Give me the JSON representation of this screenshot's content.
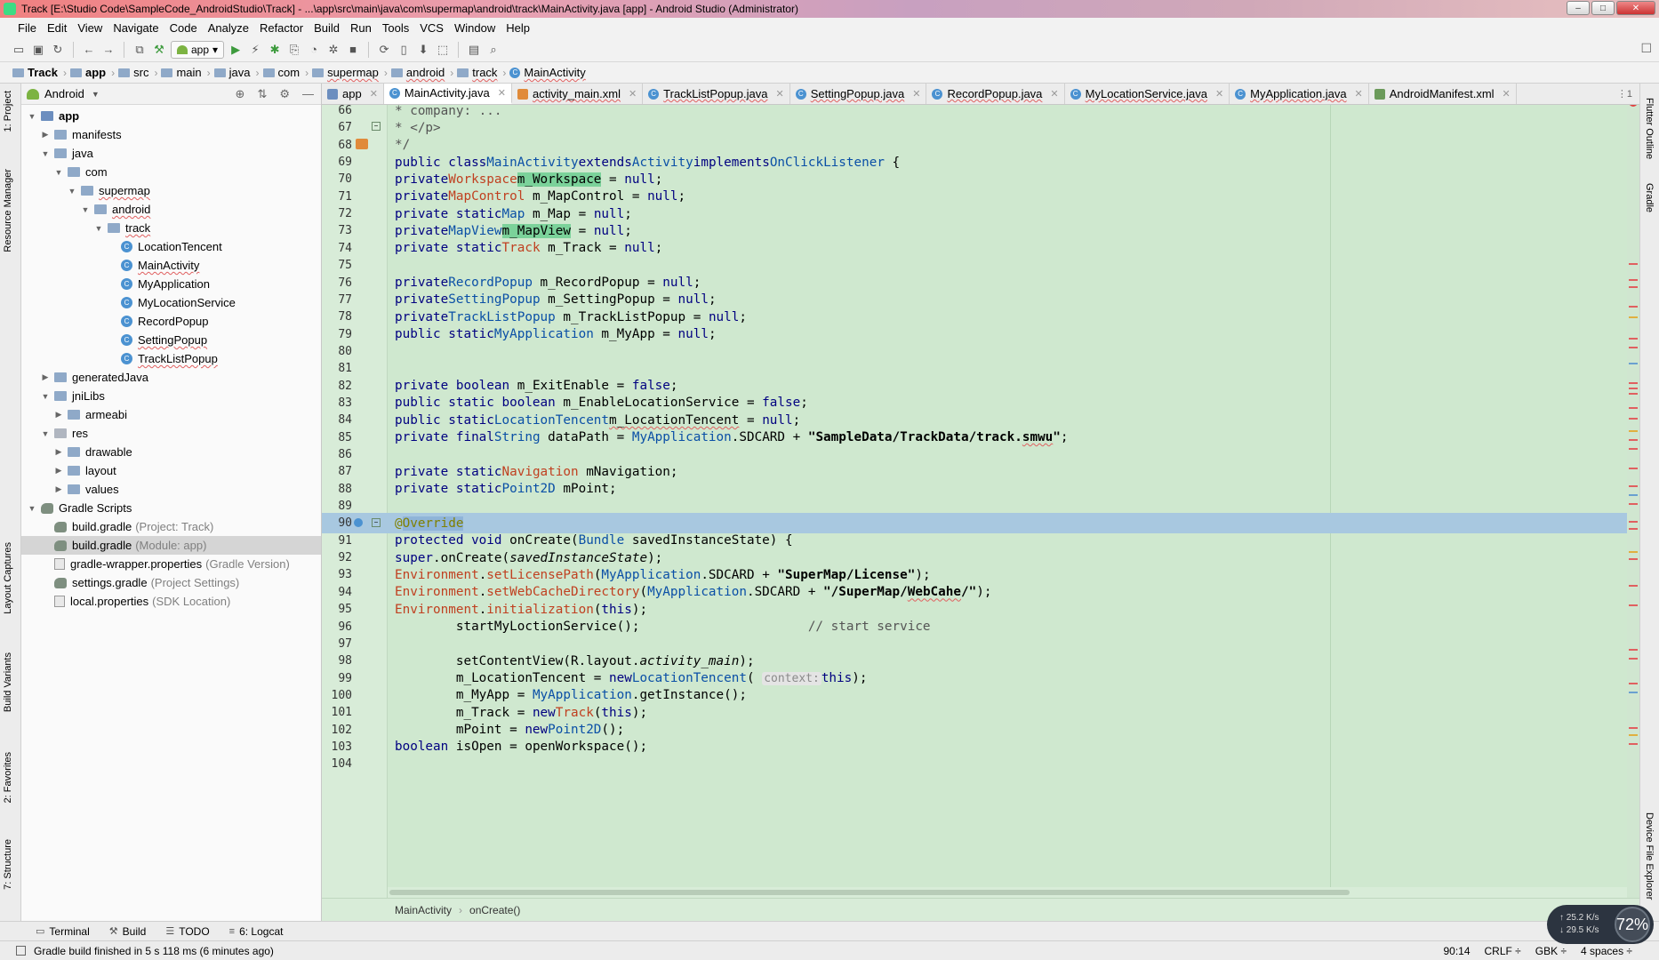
{
  "window": {
    "title": "Track [E:\\Studio Code\\SampleCode_AndroidStudio\\Track] - ...\\app\\src\\main\\java\\com\\supermap\\android\\track\\MainActivity.java [app] - Android Studio (Administrator)",
    "min": "–",
    "max": "□",
    "close": "✕"
  },
  "menu": [
    "File",
    "Edit",
    "View",
    "Navigate",
    "Code",
    "Analyze",
    "Refactor",
    "Build",
    "Run",
    "Tools",
    "VCS",
    "Window",
    "Help"
  ],
  "toolbar": {
    "run_config": "app"
  },
  "breadcrumb": [
    "Track",
    "app",
    "src",
    "main",
    "java",
    "com",
    "supermap",
    "android",
    "track",
    "MainActivity"
  ],
  "left_strip": [
    "1: Project",
    "Resource Manager",
    "Layout Captures",
    "Build Variants",
    "2: Favorites",
    "7: Structure"
  ],
  "right_strip": [
    "Flutter Outline",
    "Gradle",
    "Device File Explorer"
  ],
  "project": {
    "view": "Android",
    "tree": [
      {
        "label": "app",
        "indent": 0,
        "kind": "module",
        "expanded": true
      },
      {
        "label": "manifests",
        "indent": 1,
        "kind": "folder",
        "expanded": false
      },
      {
        "label": "java",
        "indent": 1,
        "kind": "folder",
        "expanded": true
      },
      {
        "label": "com",
        "indent": 2,
        "kind": "pkg",
        "expanded": true
      },
      {
        "label": "supermap",
        "indent": 3,
        "kind": "pkg",
        "expanded": true,
        "err": true
      },
      {
        "label": "android",
        "indent": 4,
        "kind": "pkg",
        "expanded": true,
        "err": true
      },
      {
        "label": "track",
        "indent": 5,
        "kind": "pkg",
        "expanded": true,
        "err": true
      },
      {
        "label": "LocationTencent",
        "indent": 6,
        "kind": "class"
      },
      {
        "label": "MainActivity",
        "indent": 6,
        "kind": "class",
        "err": true
      },
      {
        "label": "MyApplication",
        "indent": 6,
        "kind": "class"
      },
      {
        "label": "MyLocationService",
        "indent": 6,
        "kind": "class"
      },
      {
        "label": "RecordPopup",
        "indent": 6,
        "kind": "class"
      },
      {
        "label": "SettingPopup",
        "indent": 6,
        "kind": "class",
        "err": true
      },
      {
        "label": "TrackListPopup",
        "indent": 6,
        "kind": "class",
        "err": true
      },
      {
        "label": "generatedJava",
        "indent": 1,
        "kind": "folder",
        "expanded": false
      },
      {
        "label": "jniLibs",
        "indent": 1,
        "kind": "folder",
        "expanded": true
      },
      {
        "label": "armeabi",
        "indent": 2,
        "kind": "folder",
        "expanded": false
      },
      {
        "label": "res",
        "indent": 1,
        "kind": "res",
        "expanded": true
      },
      {
        "label": "drawable",
        "indent": 2,
        "kind": "folder",
        "expanded": false
      },
      {
        "label": "layout",
        "indent": 2,
        "kind": "folder",
        "expanded": false
      },
      {
        "label": "values",
        "indent": 2,
        "kind": "folder",
        "expanded": false
      },
      {
        "label": "Gradle Scripts",
        "indent": 0,
        "kind": "gradle",
        "expanded": true
      },
      {
        "label": "build.gradle",
        "hint": "(Project: Track)",
        "indent": 1,
        "kind": "gfile"
      },
      {
        "label": "build.gradle",
        "hint": "(Module: app)",
        "indent": 1,
        "kind": "gfile",
        "selected": true
      },
      {
        "label": "gradle-wrapper.properties",
        "hint": "(Gradle Version)",
        "indent": 1,
        "kind": "pfile"
      },
      {
        "label": "settings.gradle",
        "hint": "(Project Settings)",
        "indent": 1,
        "kind": "gfile"
      },
      {
        "label": "local.properties",
        "hint": "(SDK Location)",
        "indent": 1,
        "kind": "pfile"
      }
    ]
  },
  "tabs": [
    {
      "label": "app",
      "kind": "mod"
    },
    {
      "label": "MainActivity.java",
      "kind": "class",
      "active": true
    },
    {
      "label": "activity_main.xml",
      "kind": "xml"
    },
    {
      "label": "TrackListPopup.java",
      "kind": "class"
    },
    {
      "label": "SettingPopup.java",
      "kind": "class"
    },
    {
      "label": "RecordPopup.java",
      "kind": "class"
    },
    {
      "label": "MyLocationService.java",
      "kind": "class"
    },
    {
      "label": "MyApplication.java",
      "kind": "class"
    },
    {
      "label": "AndroidManifest.xml",
      "kind": "mf"
    }
  ],
  "tabs_more": "⋮1",
  "editor": {
    "lines": [
      {
        "n": "66",
        "html": " <span class='cm'>* company: ...</span>"
      },
      {
        "n": "67",
        "html": " <span class='cm'>* &lt;/p&gt;</span>"
      },
      {
        "n": "68",
        "html": " <span class='cm'>*/</span>"
      },
      {
        "n": "69",
        "html": "<span class='kw'>public class</span> <span class='ty'>MainActivity</span> <span class='kw'>extends</span> <span class='ty'>Activity</span> <span class='kw'>implements</span> <span class='ty'>OnClickListener</span> {"
      },
      {
        "n": "70",
        "html": "    <span class='kw'>private</span> <span class='red'>Workspace</span> <span class='hlw'>m_Workspace</span> = <span class='kw'>null</span>;"
      },
      {
        "n": "71",
        "html": "    <span class='kw'>private</span> <span class='red'>MapControl</span> m_MapControl = <span class='kw'>null</span>;"
      },
      {
        "n": "72",
        "html": "    <span class='kw'>private static</span> <span class='ty'>Map</span> m_Map = <span class='kw'>null</span>;"
      },
      {
        "n": "73",
        "html": "    <span class='kw'>private</span> <span class='ty'>MapView</span> <span class='hlw'>m_MapView</span> = <span class='kw'>null</span>;"
      },
      {
        "n": "74",
        "html": "    <span class='kw'>private static</span> <span class='red'>Track</span> m_Track = <span class='kw'>null</span>;"
      },
      {
        "n": "75",
        "html": ""
      },
      {
        "n": "76",
        "html": "    <span class='kw'>private</span> <span class='ty'>RecordPopup</span> m_RecordPopup = <span class='kw'>null</span>;"
      },
      {
        "n": "77",
        "html": "    <span class='kw'>private</span> <span class='ty'>SettingPopup</span> m_SettingPopup = <span class='kw'>null</span>;"
      },
      {
        "n": "78",
        "html": "    <span class='kw'>private</span> <span class='ty'>TrackListPopup</span> m_TrackListPopup = <span class='kw'>null</span>;"
      },
      {
        "n": "79",
        "html": "    <span class='kw'>public static</span> <span class='ty'>MyApplication</span> m_MyApp = <span class='kw'>null</span>;"
      },
      {
        "n": "80",
        "html": ""
      },
      {
        "n": "81",
        "html": ""
      },
      {
        "n": "82",
        "html": "    <span class='kw'>private boolean</span> m_ExitEnable = <span class='kw'>false</span>;"
      },
      {
        "n": "83",
        "html": "    <span class='kw'>public static boolean</span> m_EnableLocationService = <span class='kw'>false</span>;"
      },
      {
        "n": "84",
        "html": "    <span class='kw'>public static</span> <span class='ty'>LocationTencent</span> <span class='underline-red'>m_LocationTencent</span> = <span class='kw'>null</span>;"
      },
      {
        "n": "85",
        "html": "    <span class='kw'>private final</span> <span class='ty'>String</span> dataPath = <span class='ty'>MyApplication</span>.SDCARD + <span class='str'>\"SampleData/TrackData/track.<span class='underline-red'>smwu</span>\"</span>;"
      },
      {
        "n": "86",
        "html": ""
      },
      {
        "n": "87",
        "html": "    <span class='kw'>private static</span> <span class='red'>Navigation</span> mNavigation;"
      },
      {
        "n": "88",
        "html": "    <span class='kw'>private static</span> <span class='ty'>Point2D</span> mPoint;"
      },
      {
        "n": "89",
        "html": ""
      },
      {
        "n": "90",
        "html": "    <span style='color:#808000'>@</span><span style='color:#808000;background:#8fb4d8'>Override</span>",
        "current": true
      },
      {
        "n": "91",
        "html": "    <span class='kw'>protected void</span> onCreate(<span class='ty'>Bundle</span> savedInstanceState) {"
      },
      {
        "n": "92",
        "html": "        <span class='kw'>super</span>.onCreate(<span class='it'>savedInstanceState</span>);"
      },
      {
        "n": "93",
        "html": "        <span class='red'>Environment</span>.<span class='red'>setLicensePath</span>(<span class='ty'>MyApplication</span>.SDCARD + <span class='str'>\"SuperMap/License\"</span>);"
      },
      {
        "n": "94",
        "html": "        <span class='red'>Environment</span>.<span class='red'>setWebCacheDirectory</span>(<span class='ty'>MyApplication</span>.SDCARD + <span class='str'>\"/SuperMap/<span class='underline-red'>WebCahe</span>/\"</span>);"
      },
      {
        "n": "95",
        "html": "        <span class='red'>Environment</span>.<span class='red'>initialization</span>(<span class='kw'>this</span>);"
      },
      {
        "n": "96",
        "html": "        startMyLoctionService();                      <span class='cm'>// start service</span>"
      },
      {
        "n": "97",
        "html": ""
      },
      {
        "n": "98",
        "html": "        setContentView(R.layout.<span class='it'>activity_main</span>);"
      },
      {
        "n": "99",
        "html": "        m_LocationTencent = <span class='kw'>new</span> <span class='ty'>LocationTencent</span>( <span class='hint-box'>context:</span> <span class='kw'>this</span>);"
      },
      {
        "n": "100",
        "html": "        m_MyApp = <span class='ty'>MyApplication</span>.getInstance();"
      },
      {
        "n": "101",
        "html": "        m_Track = <span class='kw'>new</span> <span class='red'>Track</span>(<span class='kw'>this</span>);"
      },
      {
        "n": "102",
        "html": "        mPoint = <span class='kw'>new</span> <span class='ty'>Point2D</span>();"
      },
      {
        "n": "103",
        "html": "        <span class='kw'>boolean</span> isOpen = openWorkspace();"
      },
      {
        "n": "104",
        "html": ""
      }
    ]
  },
  "editor_breadcrumb": [
    "MainActivity",
    "onCreate()"
  ],
  "bottom_tabs": [
    "Terminal",
    "Build",
    "TODO",
    "6: Logcat"
  ],
  "status": {
    "message": "Gradle build finished in 5 s 118 ms (6 minutes ago)",
    "position": "90:14",
    "line_sep": "CRLF ÷",
    "encoding": "GBK ÷",
    "indent": "4 spaces ÷"
  },
  "net": {
    "up": "↑ 25.2 K/s",
    "down": "↓ 29.5 K/s",
    "cpu": "72%"
  }
}
